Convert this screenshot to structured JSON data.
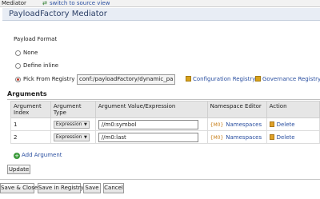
{
  "topbar": {
    "tab_label": "Mediator",
    "switch_link": "switch to source view"
  },
  "header": {
    "title": "PayloadFactory Mediator"
  },
  "payload_format": {
    "label": "Payload Format",
    "options": [
      {
        "label": "None",
        "selected": false
      },
      {
        "label": "Define inline",
        "selected": false
      },
      {
        "label": "Pick From Registry",
        "selected": true
      }
    ],
    "registry_value": "conf:/payloadFactory/dynamic_pa",
    "configuration_registry_link": "Configuration Registry",
    "governance_registry_link": "Governance Registry"
  },
  "arguments": {
    "section_title": "Arguments",
    "columns": [
      "Argument Index",
      "Argument Type",
      "Argument Value/Expression",
      "Namespace Editor",
      "Action"
    ],
    "rows": [
      {
        "index": "1",
        "type": "Expression",
        "value": "//m0:symbol",
        "namespace_icon": "{M0}",
        "namespace_link": "Namespaces",
        "action": "Delete"
      },
      {
        "index": "2",
        "type": "Expression",
        "value": "//m0:last",
        "namespace_icon": "{M0}",
        "namespace_link": "Namespaces",
        "action": "Delete"
      }
    ],
    "add_label": "Add Argument"
  },
  "update_button": "Update",
  "footer_buttons": {
    "save_close": "Save & Close",
    "save_registry": "Save in Registry",
    "save": "Save",
    "cancel": "Cancel"
  },
  "colors": {
    "link": "#2a4fa0",
    "title_bar": "#e8edf5",
    "selected_radio": "#c0392b"
  }
}
